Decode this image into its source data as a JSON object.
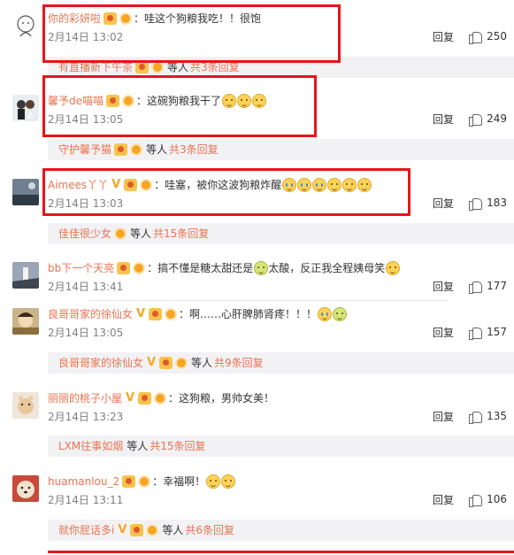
{
  "comments": [
    {
      "user": "你的彩妍啦",
      "badges": [
        "vip",
        "medal"
      ],
      "text": "：哇这个狗粮我吃！！很饱",
      "emojis": [],
      "date": "2月14日 13:02",
      "reply": "回复",
      "likes": "250",
      "sub": {
        "user": "有直播新下午茶",
        "etc": "等人",
        "more": "共3条回复"
      }
    },
    {
      "user": "馨予de喵喵",
      "badges": [
        "vip",
        "medal"
      ],
      "text": "：这碗狗粮我干了",
      "emojis": [
        "smile",
        "smile",
        "smile"
      ],
      "date": "2月14日 13:05",
      "reply": "回复",
      "likes": "249",
      "sub": {
        "user": "守护馨予猫",
        "etc": "等人",
        "more": "共3条回复"
      }
    },
    {
      "user": "Aimees丫丫",
      "badges": [
        "vmark",
        "vip",
        "medal"
      ],
      "text": "：哇塞，被你这波狗粮炸醒",
      "emojis": [
        "cry",
        "cry",
        "cry",
        "smile",
        "smile",
        "smile"
      ],
      "date": "2月14日 13:03",
      "reply": "回复",
      "likes": "183",
      "sub": {
        "user": "佳佳很少女",
        "etc": "等人",
        "more": "共15条回复"
      }
    },
    {
      "user": "bb下一个天亮",
      "badges": [
        "vip",
        "medal"
      ],
      "text": "：搞不懂是糖太甜还是",
      "text2": "太酸，反正我全程姨母笑",
      "emojis": [],
      "date": "2月14日 13:41",
      "reply": "回复",
      "likes": "177"
    },
    {
      "user": "良哥哥家的徐仙女",
      "badges": [
        "vmark",
        "vip",
        "medal"
      ],
      "text": "：啊……心肝脾肺肾疼！！！",
      "emojis": [
        "cry",
        "green"
      ],
      "date": "2月14日 13:05",
      "reply": "回复",
      "likes": "157",
      "sub": {
        "user": "良哥哥家的徐仙女",
        "etc": "等人",
        "more": "共9条回复"
      }
    },
    {
      "user": "丽丽的桃子小屋",
      "badges": [
        "vmark",
        "vip",
        "medal"
      ],
      "text": "：这狗粮，男帅女美！",
      "emojis": [],
      "date": "2月14日 13:23",
      "reply": "回复",
      "likes": "135",
      "sub": {
        "user": "LXM往事如烟",
        "etc": "等人",
        "more": "共15条回复"
      }
    },
    {
      "user": "huamanlou_2",
      "badges": [
        "vip",
        "medal"
      ],
      "text": "：幸福啊！",
      "emojis": [
        "smile",
        "smile"
      ],
      "date": "2月14日 13:11",
      "reply": "回复",
      "likes": "106",
      "sub": {
        "user": "就你屁话多i",
        "etc": "等人",
        "more": "共6条回复"
      }
    }
  ]
}
